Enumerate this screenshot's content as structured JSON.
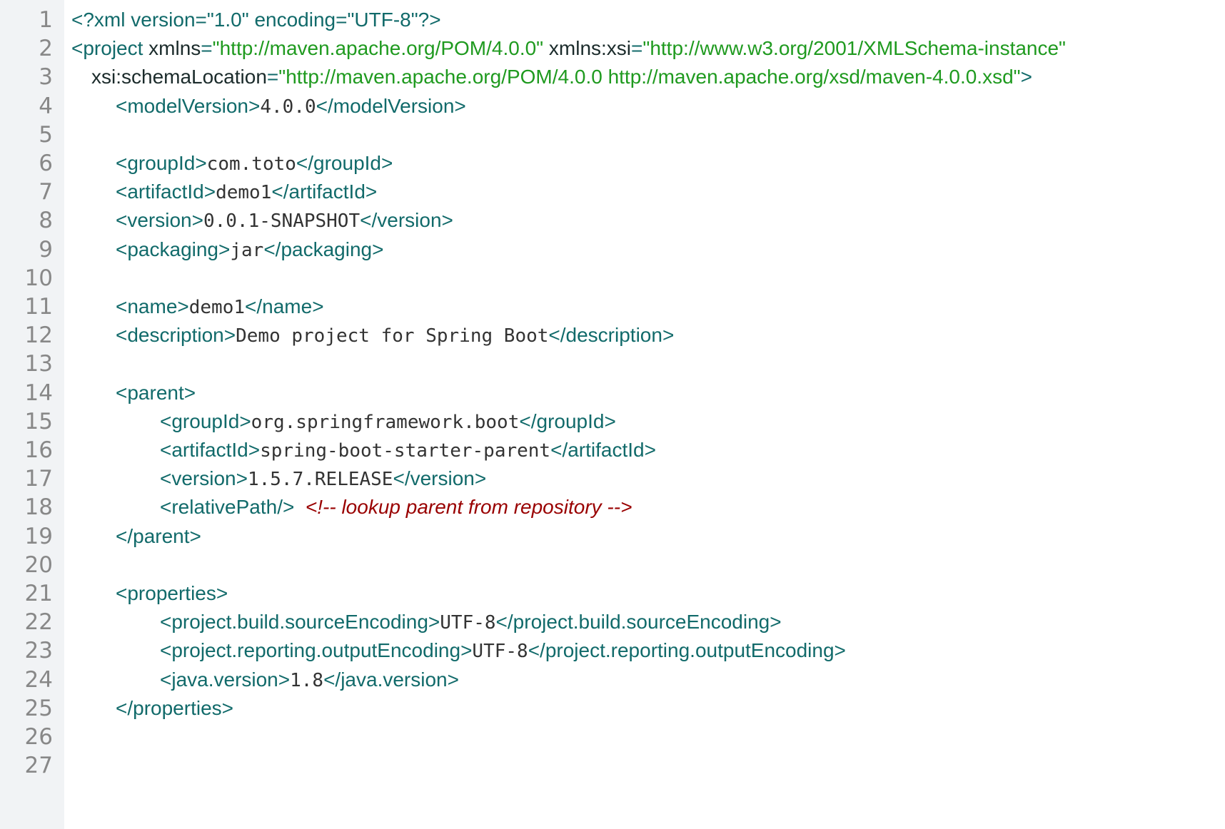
{
  "colors": {
    "tag": "#116a6a",
    "string": "#1f9a1f",
    "text": "#333333",
    "comment": "#990000",
    "gutter": "#f1f3f5",
    "line_number": "#888888"
  },
  "editor": {
    "lines": [
      {
        "n": "1",
        "tokens": [
          {
            "t": "tag",
            "s": "<?xml version=\"1.0\" encoding=\"UTF-8\"?>"
          }
        ]
      },
      {
        "n": "2",
        "tokens": [
          {
            "t": "tag",
            "s": "<project "
          },
          {
            "t": "attr",
            "s": "xmlns"
          },
          {
            "t": "tag",
            "s": "="
          },
          {
            "t": "str",
            "s": "\"http://maven.apache.org/POM/4.0.0\""
          },
          {
            "t": "attr",
            "s": " xmlns:xsi"
          },
          {
            "t": "tag",
            "s": "="
          },
          {
            "t": "str",
            "s": "\"http://www.w3.org/2001/XMLSchema-instance\""
          }
        ]
      },
      {
        "n": "3",
        "tokens": [
          {
            "t": "attr",
            "s": "xsi:schemaLocation"
          },
          {
            "t": "tag",
            "s": "="
          },
          {
            "t": "str",
            "s": "\"http://maven.apache.org/POM/4.0.0 http://maven.apache.org/xsd/maven-4.0.0.xsd\""
          },
          {
            "t": "tag",
            "s": ">"
          }
        ]
      },
      {
        "n": "4",
        "tokens": [
          {
            "t": "tag",
            "s": "<modelVersion>"
          },
          {
            "t": "val",
            "s": "4.0.0"
          },
          {
            "t": "tag",
            "s": "</modelVersion>"
          }
        ]
      },
      {
        "n": "5",
        "tokens": []
      },
      {
        "n": "6",
        "tokens": [
          {
            "t": "tag",
            "s": "<groupId>"
          },
          {
            "t": "val",
            "s": "com.toto"
          },
          {
            "t": "tag",
            "s": "</groupId>"
          }
        ]
      },
      {
        "n": "7",
        "tokens": [
          {
            "t": "tag",
            "s": "<artifactId>"
          },
          {
            "t": "val",
            "s": "demo1"
          },
          {
            "t": "tag",
            "s": "</artifactId>"
          }
        ]
      },
      {
        "n": "8",
        "tokens": [
          {
            "t": "tag",
            "s": "<version>"
          },
          {
            "t": "val",
            "s": "0.0.1-SNAPSHOT"
          },
          {
            "t": "tag",
            "s": "</version>"
          }
        ]
      },
      {
        "n": "9",
        "tokens": [
          {
            "t": "tag",
            "s": "<packaging>"
          },
          {
            "t": "val",
            "s": "jar"
          },
          {
            "t": "tag",
            "s": "</packaging>"
          }
        ]
      },
      {
        "n": "10",
        "tokens": []
      },
      {
        "n": "11",
        "tokens": [
          {
            "t": "tag",
            "s": "<name>"
          },
          {
            "t": "val",
            "s": "demo1"
          },
          {
            "t": "tag",
            "s": "</name>"
          }
        ]
      },
      {
        "n": "12",
        "tokens": [
          {
            "t": "tag",
            "s": "<description>"
          },
          {
            "t": "val",
            "s": "Demo project for Spring Boot"
          },
          {
            "t": "tag",
            "s": "</description>"
          }
        ]
      },
      {
        "n": "13",
        "tokens": []
      },
      {
        "n": "14",
        "tokens": [
          {
            "t": "tag",
            "s": "<parent>"
          }
        ]
      },
      {
        "n": "15",
        "tokens": [
          {
            "t": "tag",
            "s": "<groupId>"
          },
          {
            "t": "val",
            "s": "org.springframework.boot"
          },
          {
            "t": "tag",
            "s": "</groupId>"
          }
        ]
      },
      {
        "n": "16",
        "tokens": [
          {
            "t": "tag",
            "s": "<artifactId>"
          },
          {
            "t": "val",
            "s": "spring-boot-starter-parent"
          },
          {
            "t": "tag",
            "s": "</artifactId>"
          }
        ]
      },
      {
        "n": "17",
        "tokens": [
          {
            "t": "tag",
            "s": "<version>"
          },
          {
            "t": "val",
            "s": "1.5.7.RELEASE"
          },
          {
            "t": "tag",
            "s": "</version>"
          }
        ]
      },
      {
        "n": "18",
        "tokens": [
          {
            "t": "tag",
            "s": "<relativePath/>"
          },
          {
            "t": "plain",
            "s": "  "
          },
          {
            "t": "cmt",
            "s": "<!-- lookup parent from repository -->"
          }
        ]
      },
      {
        "n": "19",
        "tokens": [
          {
            "t": "tag",
            "s": "</parent>"
          }
        ]
      },
      {
        "n": "20",
        "tokens": []
      },
      {
        "n": "21",
        "tokens": [
          {
            "t": "tag",
            "s": "<properties>"
          }
        ]
      },
      {
        "n": "22",
        "tokens": [
          {
            "t": "tag",
            "s": "<project.build.sourceEncoding>"
          },
          {
            "t": "val",
            "s": "UTF-8"
          },
          {
            "t": "tag",
            "s": "</project.build.sourceEncoding>"
          }
        ]
      },
      {
        "n": "23",
        "tokens": [
          {
            "t": "tag",
            "s": "<project.reporting.outputEncoding>"
          },
          {
            "t": "val",
            "s": "UTF-8"
          },
          {
            "t": "tag",
            "s": "</project.reporting.outputEncoding>"
          }
        ]
      },
      {
        "n": "24",
        "tokens": [
          {
            "t": "tag",
            "s": "<java.version>"
          },
          {
            "t": "val",
            "s": "1.8"
          },
          {
            "t": "tag",
            "s": "</java.version>"
          }
        ]
      },
      {
        "n": "25",
        "tokens": [
          {
            "t": "tag",
            "s": "</properties>"
          }
        ]
      },
      {
        "n": "26",
        "tokens": []
      },
      {
        "n": "27",
        "tokens": []
      }
    ]
  }
}
